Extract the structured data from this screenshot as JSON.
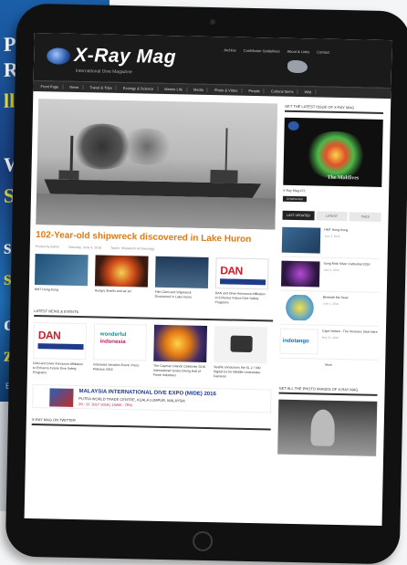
{
  "background_magazine": {
    "lines": [
      {
        "text": "Pr",
        "yellow": false
      },
      {
        "text": "R",
        "yellow": false
      },
      {
        "text": "ll",
        "yellow": true
      },
      {
        "text": "Wr",
        "yellow": false
      },
      {
        "text": "Su",
        "yellow": true
      },
      {
        "text": "sl",
        "yellow": false
      },
      {
        "text": "s",
        "yellow": true
      },
      {
        "text": "dp",
        "yellow": false
      },
      {
        "text": "z",
        "yellow": true
      }
    ],
    "footer": "BY"
  },
  "site": {
    "logo": "X-Ray Mag",
    "tagline": "International Dive Magazine",
    "top_links": [
      "Archive",
      "Contributor Guidelines",
      "About & Links",
      "Contact"
    ],
    "nav": [
      "Front Page",
      "News",
      "Travel & Trips",
      "Ecology & Science",
      "Marine Life",
      "Media",
      "Photo & Video",
      "People",
      "Cultural Items",
      "Wild"
    ]
  },
  "hero": {
    "headline": "102-Year-old shipwreck discovered in Lake Huron",
    "meta": [
      "Posted by Admin",
      "Saturday, June 4, 2016",
      "Topics: Shipwreck Archaeology"
    ]
  },
  "thumbs": [
    {
      "caption": "HMT Hong Kong",
      "style": "t1"
    },
    {
      "caption": "Hungry Sharks and air art",
      "style": "t2"
    },
    {
      "caption": "Film Clam and Shipwreck Discovered in Lake Huron",
      "style": "t3"
    },
    {
      "caption": "DAN and Diver Announce Affiliation to Enhance Future Dive Safety Programs",
      "style": "t4"
    }
  ],
  "dan_logo": "DAN",
  "latest_news_heading": "LATEST NEWS & EVENTS",
  "thumbs2": [
    {
      "caption": "DAN and Diver Announce Affiliation to Enhance Future Dive Safety Programs",
      "style": "u1"
    },
    {
      "caption": "Indonesia Vacation Event: Press Release 2016",
      "style": "u2"
    },
    {
      "caption": "The Cayman Islands Celebrate 2016 International Scuba Diving Hall of Fame Inductees",
      "style": "u3"
    },
    {
      "caption": "Sealife announces the SL 2 / 300 Digital Ca for Wildlife Underwater Cameras",
      "style": "u4"
    }
  ],
  "indonesia_text": [
    "wonderful",
    "indonesia"
  ],
  "banner": {
    "line1": "MALAYSIA INTERNATIONAL DIVE EXPO (MIDE) 2016",
    "line2": "PUTRA WORLD TRADE CENTRE, KUALA LUMPUR, MALAYSIA",
    "line3": "29 - 31 JULY 2016 | 10AM - 7PM"
  },
  "twitter_heading": "X-RAY MAG ON TWITTER",
  "right": {
    "latest_issue_heading": "GET THE LATEST ISSUE OF X-RAY MAG",
    "mag_title": "The Maldives",
    "mag_caption": "X-Ray Mag #72",
    "mag_button": "DOWNLOAD",
    "tabs": [
      {
        "label": "LAST UPDATED",
        "active": true
      },
      {
        "label": "LATEST",
        "active": false
      },
      {
        "label": "TAGS",
        "active": false
      }
    ],
    "items": [
      {
        "title": "HMT Hong Kong",
        "date": "June 3, 2016",
        "style": "r1",
        "label": ""
      },
      {
        "title": "Song Ride Silver Cathedral 2016",
        "date": "June 2, 2016",
        "style": "r2",
        "label": ""
      },
      {
        "title": "Beneath the Seas",
        "date": "June 1, 2016",
        "style": "r3",
        "label": ""
      },
      {
        "title": "Cape Nature - The Ventures Start Here",
        "date": "May 31, 2016",
        "style": "r4",
        "label": "indotango"
      }
    ],
    "more": "More",
    "photo_heading": "GET ALL THE PHOTO IMAGES OF X-RAY MAG"
  }
}
